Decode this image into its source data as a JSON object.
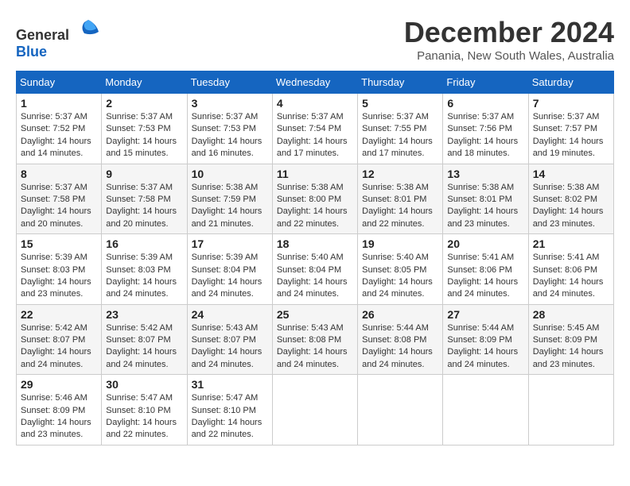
{
  "logo": {
    "general": "General",
    "blue": "Blue"
  },
  "title": "December 2024",
  "subtitle": "Panania, New South Wales, Australia",
  "days_of_week": [
    "Sunday",
    "Monday",
    "Tuesday",
    "Wednesday",
    "Thursday",
    "Friday",
    "Saturday"
  ],
  "weeks": [
    [
      {
        "day": "1",
        "sunrise": "5:37 AM",
        "sunset": "7:52 PM",
        "daylight": "14 hours and 14 minutes."
      },
      {
        "day": "2",
        "sunrise": "5:37 AM",
        "sunset": "7:53 PM",
        "daylight": "14 hours and 15 minutes."
      },
      {
        "day": "3",
        "sunrise": "5:37 AM",
        "sunset": "7:53 PM",
        "daylight": "14 hours and 16 minutes."
      },
      {
        "day": "4",
        "sunrise": "5:37 AM",
        "sunset": "7:54 PM",
        "daylight": "14 hours and 17 minutes."
      },
      {
        "day": "5",
        "sunrise": "5:37 AM",
        "sunset": "7:55 PM",
        "daylight": "14 hours and 17 minutes."
      },
      {
        "day": "6",
        "sunrise": "5:37 AM",
        "sunset": "7:56 PM",
        "daylight": "14 hours and 18 minutes."
      },
      {
        "day": "7",
        "sunrise": "5:37 AM",
        "sunset": "7:57 PM",
        "daylight": "14 hours and 19 minutes."
      }
    ],
    [
      {
        "day": "8",
        "sunrise": "5:37 AM",
        "sunset": "7:58 PM",
        "daylight": "14 hours and 20 minutes."
      },
      {
        "day": "9",
        "sunrise": "5:37 AM",
        "sunset": "7:58 PM",
        "daylight": "14 hours and 20 minutes."
      },
      {
        "day": "10",
        "sunrise": "5:38 AM",
        "sunset": "7:59 PM",
        "daylight": "14 hours and 21 minutes."
      },
      {
        "day": "11",
        "sunrise": "5:38 AM",
        "sunset": "8:00 PM",
        "daylight": "14 hours and 22 minutes."
      },
      {
        "day": "12",
        "sunrise": "5:38 AM",
        "sunset": "8:01 PM",
        "daylight": "14 hours and 22 minutes."
      },
      {
        "day": "13",
        "sunrise": "5:38 AM",
        "sunset": "8:01 PM",
        "daylight": "14 hours and 23 minutes."
      },
      {
        "day": "14",
        "sunrise": "5:38 AM",
        "sunset": "8:02 PM",
        "daylight": "14 hours and 23 minutes."
      }
    ],
    [
      {
        "day": "15",
        "sunrise": "5:39 AM",
        "sunset": "8:03 PM",
        "daylight": "14 hours and 23 minutes."
      },
      {
        "day": "16",
        "sunrise": "5:39 AM",
        "sunset": "8:03 PM",
        "daylight": "14 hours and 24 minutes."
      },
      {
        "day": "17",
        "sunrise": "5:39 AM",
        "sunset": "8:04 PM",
        "daylight": "14 hours and 24 minutes."
      },
      {
        "day": "18",
        "sunrise": "5:40 AM",
        "sunset": "8:04 PM",
        "daylight": "14 hours and 24 minutes."
      },
      {
        "day": "19",
        "sunrise": "5:40 AM",
        "sunset": "8:05 PM",
        "daylight": "14 hours and 24 minutes."
      },
      {
        "day": "20",
        "sunrise": "5:41 AM",
        "sunset": "8:06 PM",
        "daylight": "14 hours and 24 minutes."
      },
      {
        "day": "21",
        "sunrise": "5:41 AM",
        "sunset": "8:06 PM",
        "daylight": "14 hours and 24 minutes."
      }
    ],
    [
      {
        "day": "22",
        "sunrise": "5:42 AM",
        "sunset": "8:07 PM",
        "daylight": "14 hours and 24 minutes."
      },
      {
        "day": "23",
        "sunrise": "5:42 AM",
        "sunset": "8:07 PM",
        "daylight": "14 hours and 24 minutes."
      },
      {
        "day": "24",
        "sunrise": "5:43 AM",
        "sunset": "8:07 PM",
        "daylight": "14 hours and 24 minutes."
      },
      {
        "day": "25",
        "sunrise": "5:43 AM",
        "sunset": "8:08 PM",
        "daylight": "14 hours and 24 minutes."
      },
      {
        "day": "26",
        "sunrise": "5:44 AM",
        "sunset": "8:08 PM",
        "daylight": "14 hours and 24 minutes."
      },
      {
        "day": "27",
        "sunrise": "5:44 AM",
        "sunset": "8:09 PM",
        "daylight": "14 hours and 24 minutes."
      },
      {
        "day": "28",
        "sunrise": "5:45 AM",
        "sunset": "8:09 PM",
        "daylight": "14 hours and 23 minutes."
      }
    ],
    [
      {
        "day": "29",
        "sunrise": "5:46 AM",
        "sunset": "8:09 PM",
        "daylight": "14 hours and 23 minutes."
      },
      {
        "day": "30",
        "sunrise": "5:47 AM",
        "sunset": "8:10 PM",
        "daylight": "14 hours and 22 minutes."
      },
      {
        "day": "31",
        "sunrise": "5:47 AM",
        "sunset": "8:10 PM",
        "daylight": "14 hours and 22 minutes."
      },
      null,
      null,
      null,
      null
    ]
  ],
  "labels": {
    "sunrise": "Sunrise:",
    "sunset": "Sunset:",
    "daylight": "Daylight:"
  }
}
